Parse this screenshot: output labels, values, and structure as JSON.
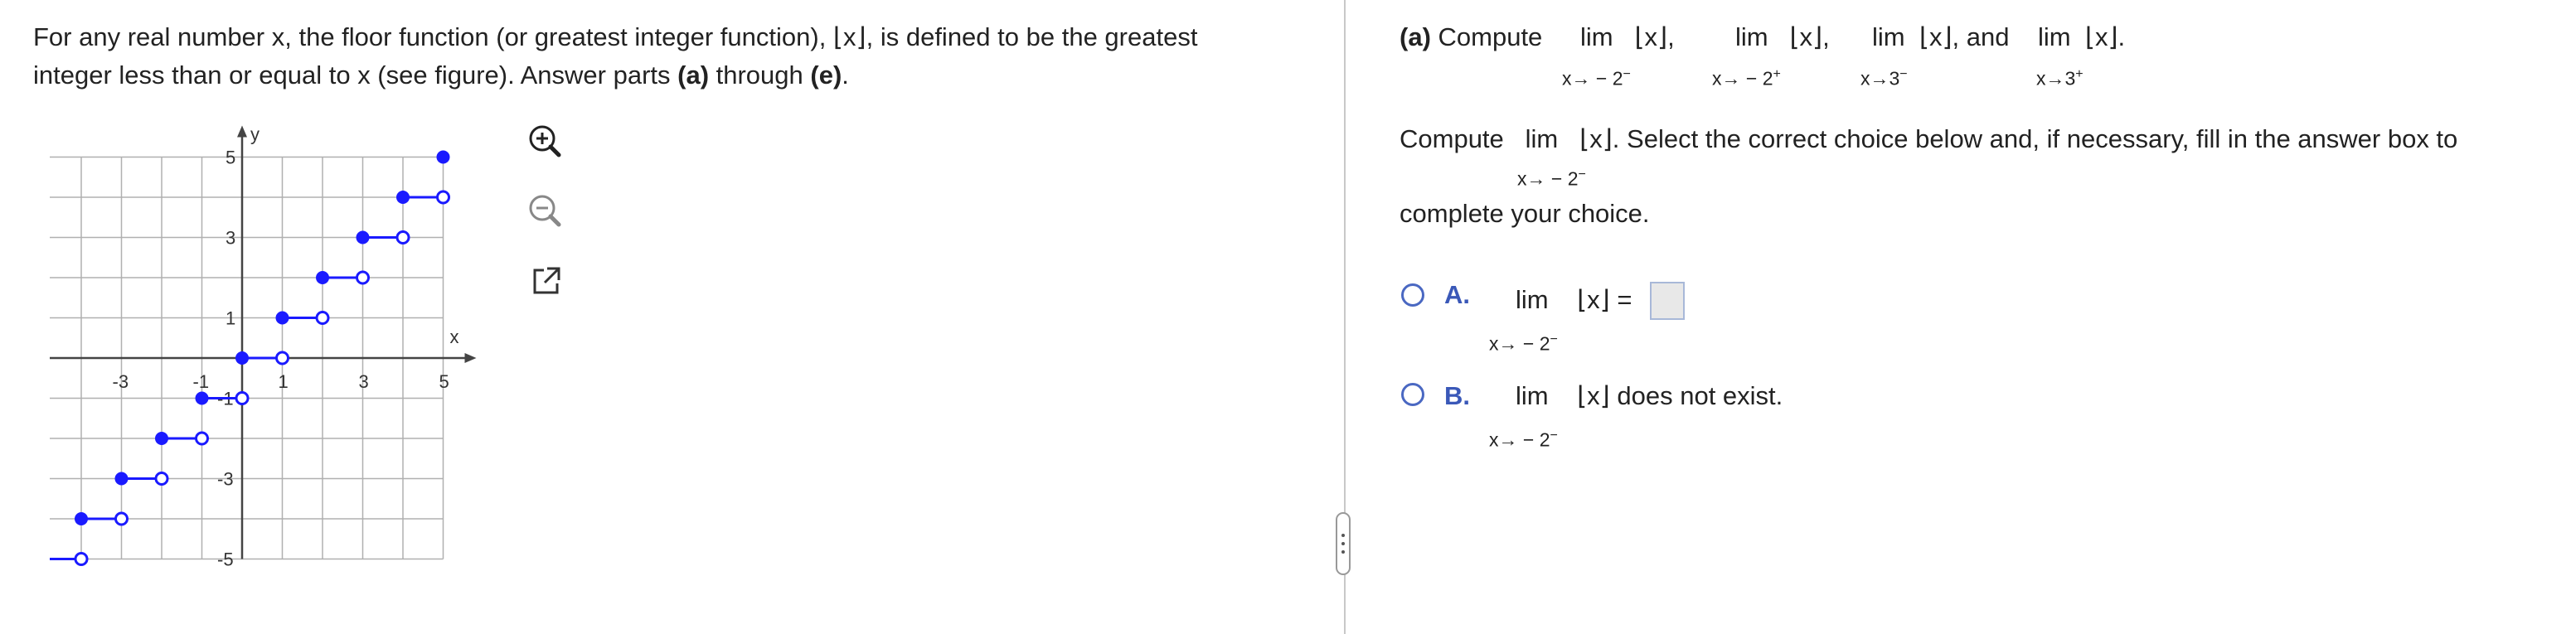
{
  "problem": {
    "intro_line1": "For any real number x, the floor function (or greatest integer function), ⌊x⌋, is defined to be the greatest",
    "intro_line2_pre": "integer less than or equal to x (see figure). Answer parts ",
    "intro_bold_a": "(a)",
    "intro_through": " through ",
    "intro_bold_e": "(e)",
    "intro_end": "."
  },
  "graph": {
    "x_axis_label": "x",
    "y_axis_label": "y",
    "x_tick_labels": [
      "-5",
      "-3",
      "-1",
      "1",
      "3",
      "5"
    ],
    "y_tick_labels": [
      "5",
      "3",
      "1",
      "-1",
      "-3",
      "-5"
    ],
    "x_range": [
      -5,
      5
    ],
    "y_range": [
      -5,
      5
    ],
    "steps_left_x": [
      -5,
      -4,
      -3,
      -2,
      -1,
      0,
      1,
      2,
      3,
      4
    ],
    "final_point": [
      5,
      5
    ],
    "step_color": "#1a1aff",
    "grid_color": "#b0b0b0"
  },
  "tools": {
    "zoom_in_icon": "zoom-in",
    "zoom_out_icon": "zoom-out",
    "popout_icon": "external-link"
  },
  "part_a": {
    "label": "(a)",
    "compute": "Compute",
    "lim": "lim",
    "floor_x": "⌊x⌋",
    "comma": ",",
    "and": "and",
    "period": ".",
    "limits": [
      {
        "sub": "x→ − 2",
        "side": "−"
      },
      {
        "sub": "x→ − 2",
        "side": "+"
      },
      {
        "sub": "x→3",
        "side": "−"
      },
      {
        "sub": "x→3",
        "side": "+"
      }
    ]
  },
  "question": {
    "compute": "Compute",
    "lim": "lim",
    "floor_x": "⌊x⌋",
    "instruction": ". Select the correct choice below and, if necessary, fill in the answer box to",
    "instruction_2": "complete your choice.",
    "sub": "x→ − 2",
    "side": "−"
  },
  "choices": [
    {
      "letter": "A.",
      "lim": "lim",
      "floor_x": "⌊x⌋",
      "text": "=",
      "sub": "x→ − 2",
      "side": "−"
    },
    {
      "letter": "B.",
      "lim": "lim",
      "floor_x": "⌊x⌋",
      "text": "does not exist.",
      "sub": "x→ − 2",
      "side": "−"
    }
  ],
  "colors": {
    "accent": "#3a58b8",
    "text": "#222222"
  }
}
